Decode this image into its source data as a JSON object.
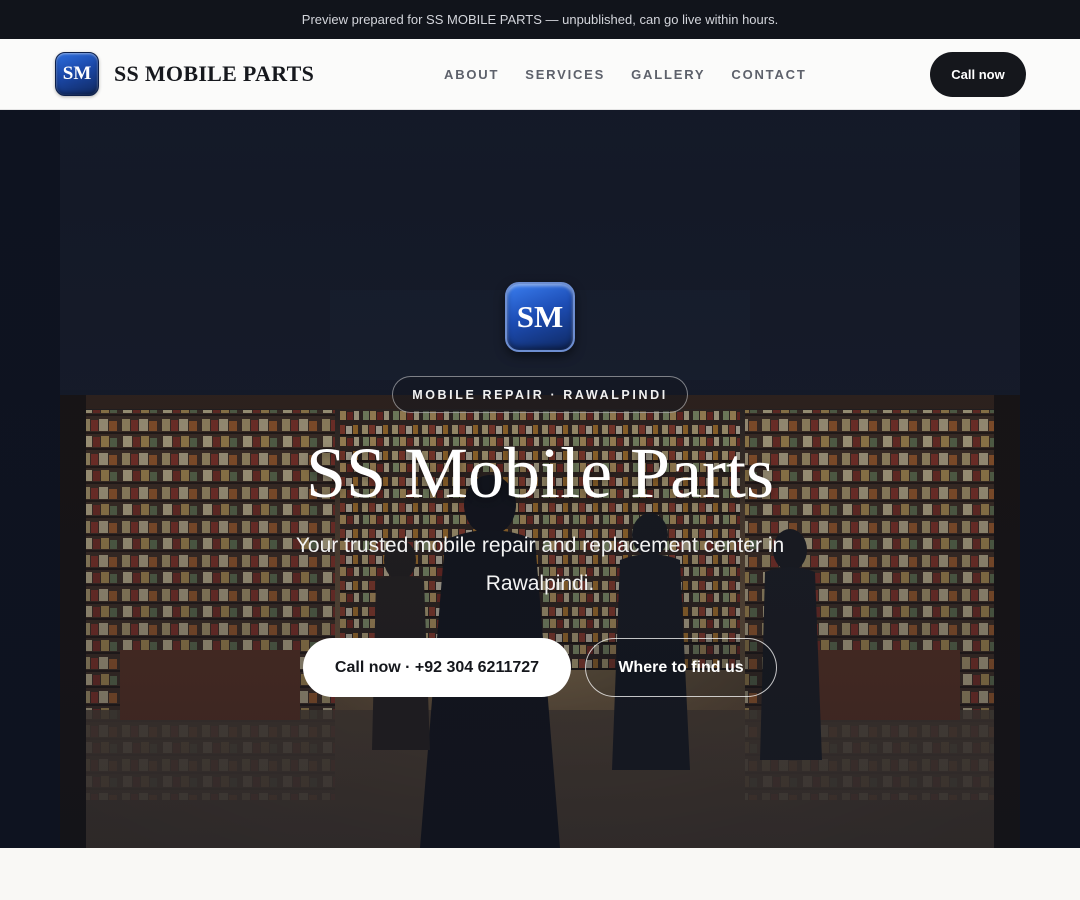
{
  "preview_banner": {
    "text": "Preview prepared for SS MOBILE PARTS — unpublished, can go live within hours."
  },
  "header": {
    "logo_text": "SM",
    "brand_name": "SS MOBILE PARTS",
    "nav": [
      {
        "label": "ABOUT"
      },
      {
        "label": "SERVICES"
      },
      {
        "label": "GALLERY"
      },
      {
        "label": "CONTACT"
      }
    ],
    "cta_label": "Call now"
  },
  "hero": {
    "logo_text": "SM",
    "tagline": "MOBILE REPAIR · RAWALPINDI",
    "title": "SS Mobile Parts",
    "subtitle": "Your trusted mobile repair and replacement center in Rawalpindi.",
    "primary_button": "Call now · +92 304 6211727",
    "secondary_button": "Where to find us",
    "background_image": "shop-interior-photo"
  },
  "colors": {
    "dark": "#15171c",
    "banner_bg": "#11141b",
    "logo_blue": "#1b48a8",
    "page_bg": "#f9f8f5"
  }
}
